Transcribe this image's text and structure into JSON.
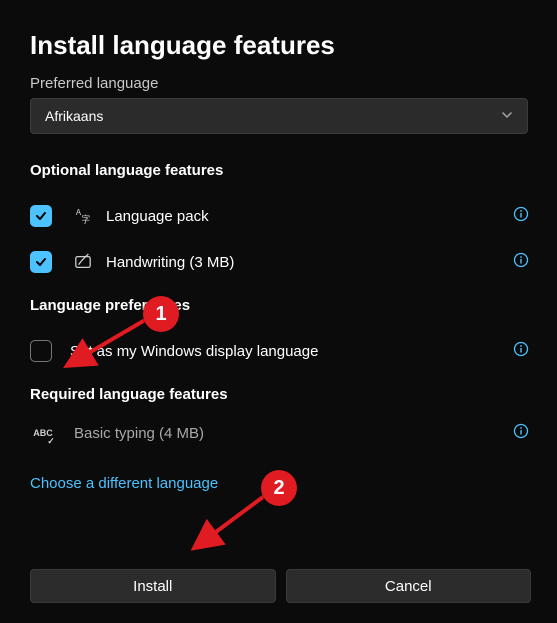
{
  "title": "Install language features",
  "preferred_language_label": "Preferred language",
  "dropdown": {
    "value": "Afrikaans"
  },
  "sections": {
    "optional": "Optional language features",
    "prefs": "Language preferences",
    "required": "Required language features"
  },
  "rows": {
    "language_pack": {
      "label": "Language pack"
    },
    "handwriting": {
      "label": "Handwriting (3 MB)"
    },
    "set_display": {
      "label": "Set as my Windows display language"
    },
    "basic_typing": {
      "label": "Basic typing (4 MB)"
    }
  },
  "link": "Choose a different language",
  "buttons": {
    "install": "Install",
    "cancel": "Cancel"
  },
  "annotations": {
    "one": "1",
    "two": "2"
  }
}
